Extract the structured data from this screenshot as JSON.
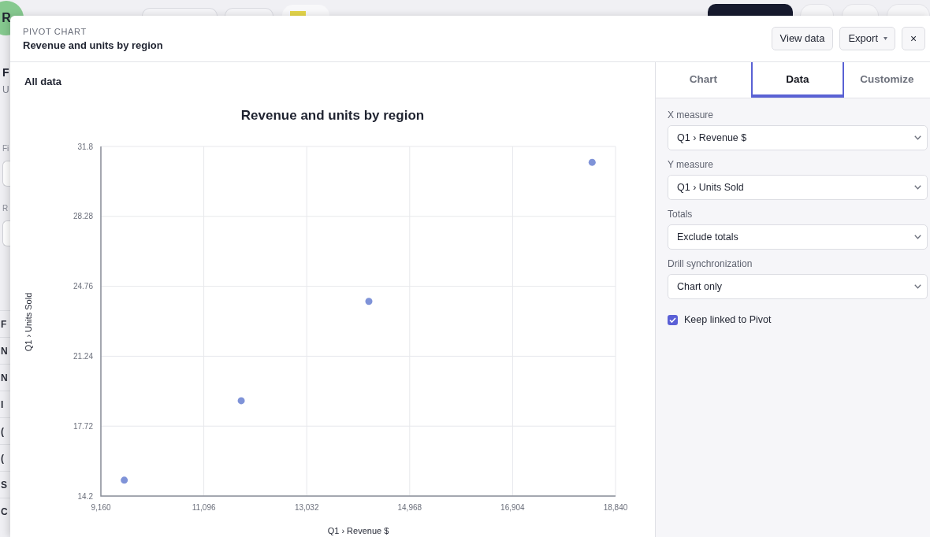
{
  "background": {
    "avatar": "R",
    "side_items": [
      {
        "kind": "title",
        "text": "F"
      },
      {
        "kind": "subtitle",
        "text": "U"
      },
      {
        "kind": "label",
        "text": "Fi"
      },
      {
        "kind": "field"
      },
      {
        "kind": "label",
        "text": "R"
      },
      {
        "kind": "field"
      },
      {
        "kind": "row",
        "text": "F"
      },
      {
        "kind": "row",
        "text": "N"
      },
      {
        "kind": "row",
        "text": "N"
      },
      {
        "kind": "row",
        "text": "I"
      },
      {
        "kind": "row",
        "text": "("
      },
      {
        "kind": "row",
        "text": "("
      },
      {
        "kind": "row",
        "text": "S"
      },
      {
        "kind": "row",
        "text": "C"
      }
    ]
  },
  "dialog": {
    "kicker": "PIVOT CHART",
    "title": "Revenue and units by region",
    "actions": [
      {
        "kind": "button",
        "label": "View data"
      },
      {
        "kind": "menu",
        "label": "Export"
      },
      {
        "kind": "close",
        "label": "×"
      }
    ]
  },
  "chart_panel": {
    "scope": "All data",
    "chart_data": {
      "type": "scatter",
      "title": "Revenue and units by region",
      "xlabel": "Q1 › Revenue $",
      "ylabel": "Q1 › Units Sold",
      "x": [
        9600,
        11800,
        14200,
        18400
      ],
      "series": [
        {
          "color": "#7f93d8",
          "values": [
            15,
            19,
            24,
            31
          ]
        }
      ],
      "xlim": [
        9160,
        18840
      ],
      "ylim": [
        14.2,
        31.8
      ],
      "xticks": [
        {
          "value": 9160,
          "label": "9,160"
        },
        {
          "value": 11096,
          "label": "11,096"
        },
        {
          "value": 13032,
          "label": "13,032"
        },
        {
          "value": 14968,
          "label": "14,968"
        },
        {
          "value": 16904,
          "label": "16,904"
        },
        {
          "value": 18840,
          "label": "18,840"
        }
      ],
      "yticks": [
        14.2,
        17.72,
        21.24,
        24.76,
        28.28,
        31.8
      ],
      "grid": true
    }
  },
  "settings_panel": {
    "tabs": [
      {
        "label": "Chart",
        "selected": false
      },
      {
        "label": "Data",
        "selected": true
      },
      {
        "label": "Customize",
        "selected": false
      }
    ],
    "fields": [
      {
        "label": "X measure",
        "value": "Q1 › Revenue $"
      },
      {
        "label": "Y measure",
        "value": "Q1 › Units Sold"
      },
      {
        "label": "Totals",
        "value": "Exclude totals"
      },
      {
        "label": "Drill synchronization",
        "value": "Chart only"
      }
    ],
    "options": [
      {
        "label": "Keep linked to Pivot",
        "checked": true
      }
    ]
  }
}
